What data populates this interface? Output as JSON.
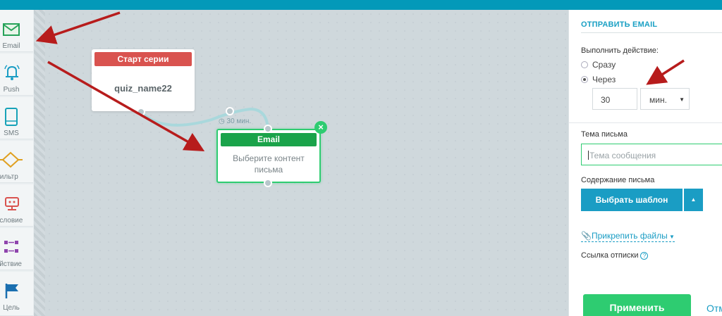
{
  "toolbox": {
    "items": [
      {
        "label": "Email",
        "icon": "email-icon"
      },
      {
        "label": "Push",
        "icon": "bell-icon"
      },
      {
        "label": "SMS",
        "icon": "phone-icon"
      },
      {
        "label": "Фильтр",
        "icon": "filter-icon"
      },
      {
        "label": "Условие",
        "icon": "robot-icon"
      },
      {
        "label": "Действие",
        "icon": "action-icon"
      },
      {
        "label": "Цель",
        "icon": "flag-icon"
      }
    ]
  },
  "canvas": {
    "start_card": {
      "title": "Старт серии",
      "name": "quiz_name22"
    },
    "delay_label": "30 мин.",
    "email_card": {
      "title": "Email",
      "body": "Выберите контент письма"
    },
    "close_symbol": "×"
  },
  "panel": {
    "title": "ОТПРАВИТЬ EMAIL",
    "action_label": "Выполнить действие:",
    "radio_now": "Сразу",
    "radio_after": "Через",
    "delay_value": "30",
    "delay_unit": "мин.",
    "subject_label": "Тема письма",
    "subject_placeholder": "Тема сообщения",
    "content_label": "Содержание письма",
    "choose_template": "Выбрать шаблон",
    "attach_files": "Прикрепить файлы",
    "unsubscribe_link": "Ссылка отписки",
    "apply": "Применить",
    "cancel": "Отм"
  },
  "colors": {
    "topbar": "#0399b9",
    "start_header": "#d9534f",
    "email_header": "#1aa34a",
    "accent_blue": "#1a9dc4",
    "accent_green": "#2ecc71",
    "annotation_arrow": "#b71c1c"
  }
}
